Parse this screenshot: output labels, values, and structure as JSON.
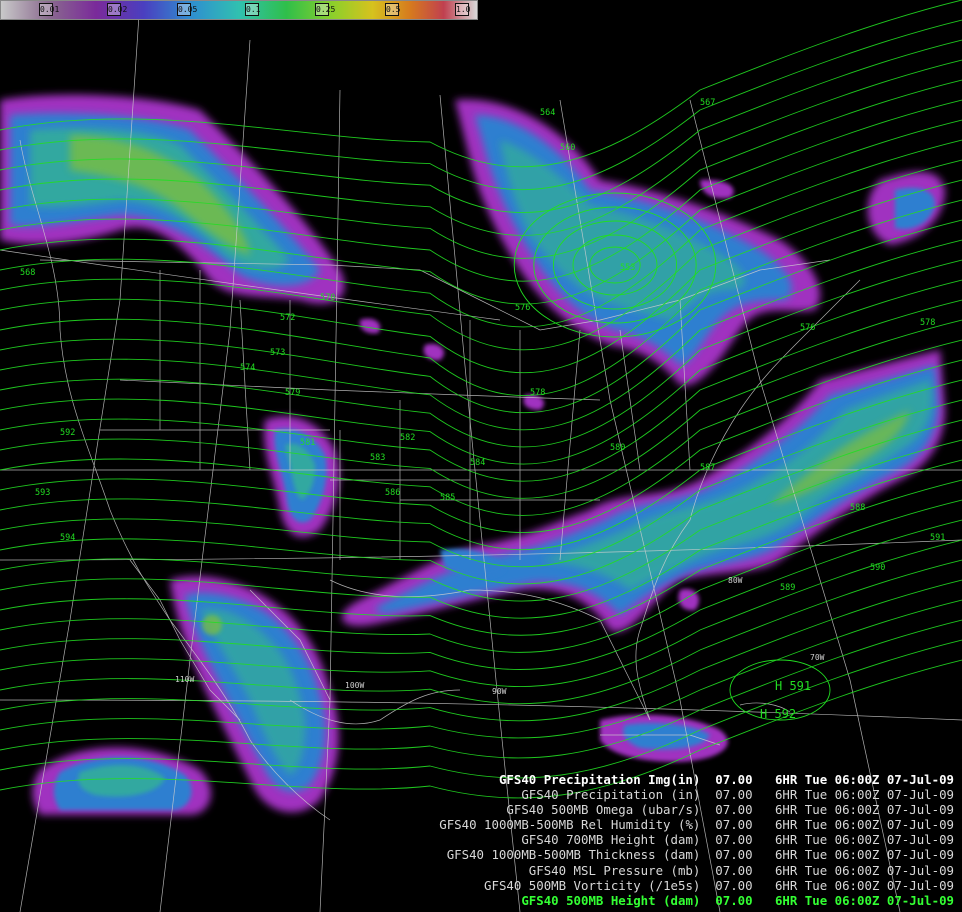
{
  "colorbar": {
    "ticks": [
      "0.01",
      "0.02",
      "0.05",
      "0.1",
      "0.25",
      "0.5",
      "1.0"
    ]
  },
  "contour_labels": {
    "heights": [
      "553",
      "560",
      "564",
      "567",
      "568",
      "570",
      "572",
      "573",
      "574",
      "576",
      "576",
      "578",
      "578",
      "579",
      "580",
      "581",
      "582",
      "583",
      "584",
      "585",
      "586",
      "587",
      "588",
      "589",
      "590",
      "591",
      "592",
      "593",
      "594"
    ],
    "highs": [
      "H 591",
      "H 592"
    ]
  },
  "lon_labels": [
    "110W",
    "100W",
    "90W",
    "80W",
    "70W"
  ],
  "legend": [
    {
      "text": "GFS40 Precipitation Img(in)  07.00   6HR Tue 06:00Z 07-Jul-09",
      "style": "bold"
    },
    {
      "text": "GFS40 Precipitation (in)  07.00   6HR Tue 06:00Z 07-Jul-09",
      "style": "normal"
    },
    {
      "text": "GFS40 500MB Omega (ubar/s)  07.00   6HR Tue 06:00Z 07-Jul-09",
      "style": "normal"
    },
    {
      "text": "GFS40 1000MB-500MB Rel Humidity (%)  07.00   6HR Tue 06:00Z 07-Jul-09",
      "style": "normal"
    },
    {
      "text": "GFS40 700MB Height (dam)  07.00   6HR Tue 06:00Z 07-Jul-09",
      "style": "normal"
    },
    {
      "text": "GFS40 1000MB-500MB Thickness (dam)  07.00   6HR Tue 06:00Z 07-Jul-09",
      "style": "normal"
    },
    {
      "text": "GFS40 MSL Pressure (mb)  07.00   6HR Tue 06:00Z 07-Jul-09",
      "style": "normal"
    },
    {
      "text": "GFS40 500MB Vorticity (/1e5s)  07.00   6HR Tue 06:00Z 07-Jul-09",
      "style": "normal"
    },
    {
      "text": "GFS40 500MB Height (dam)  07.00   6HR Tue 06:00Z 07-Jul-09",
      "style": "green"
    }
  ],
  "colors": {
    "background": "#000000",
    "contour": "#22dd22",
    "map_lines": "#cfcfcf",
    "precip_purple": "#a030c0",
    "precip_blue": "#2f7fd0",
    "precip_teal": "#30a8a0",
    "precip_green": "#7fbf3a",
    "legend_active": "#33ff33"
  }
}
